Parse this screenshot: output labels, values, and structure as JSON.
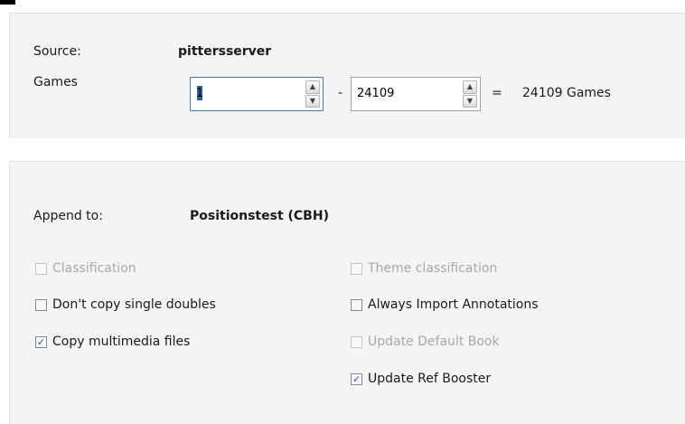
{
  "source": {
    "label": "Source:",
    "value": "pittersserver"
  },
  "games": {
    "label": "Games",
    "from_value": "1",
    "dash": "-",
    "to_value": "24109",
    "equals": "=",
    "total_text": "24109 Games"
  },
  "append": {
    "label": "Append to:",
    "value": "Positionstest (CBH)"
  },
  "options": {
    "classification": {
      "label": "Classification",
      "checked": false,
      "enabled": false
    },
    "theme_classification": {
      "label": "Theme classification",
      "checked": false,
      "enabled": false
    },
    "dont_copy_single_doubles": {
      "label": "Don't copy single doubles",
      "checked": false,
      "enabled": true
    },
    "always_import_annotations": {
      "label": "Always Import Annotations",
      "checked": false,
      "enabled": true
    },
    "copy_multimedia_files": {
      "label": "Copy multimedia files",
      "checked": true,
      "enabled": true
    },
    "update_default_book": {
      "label": "Update Default Book",
      "checked": false,
      "enabled": false
    },
    "update_ref_booster": {
      "label": "Update Ref Booster",
      "checked": true,
      "enabled": true
    }
  },
  "icons": {
    "spin_up": "▲",
    "spin_down": "▼",
    "checkmark": "✓"
  }
}
